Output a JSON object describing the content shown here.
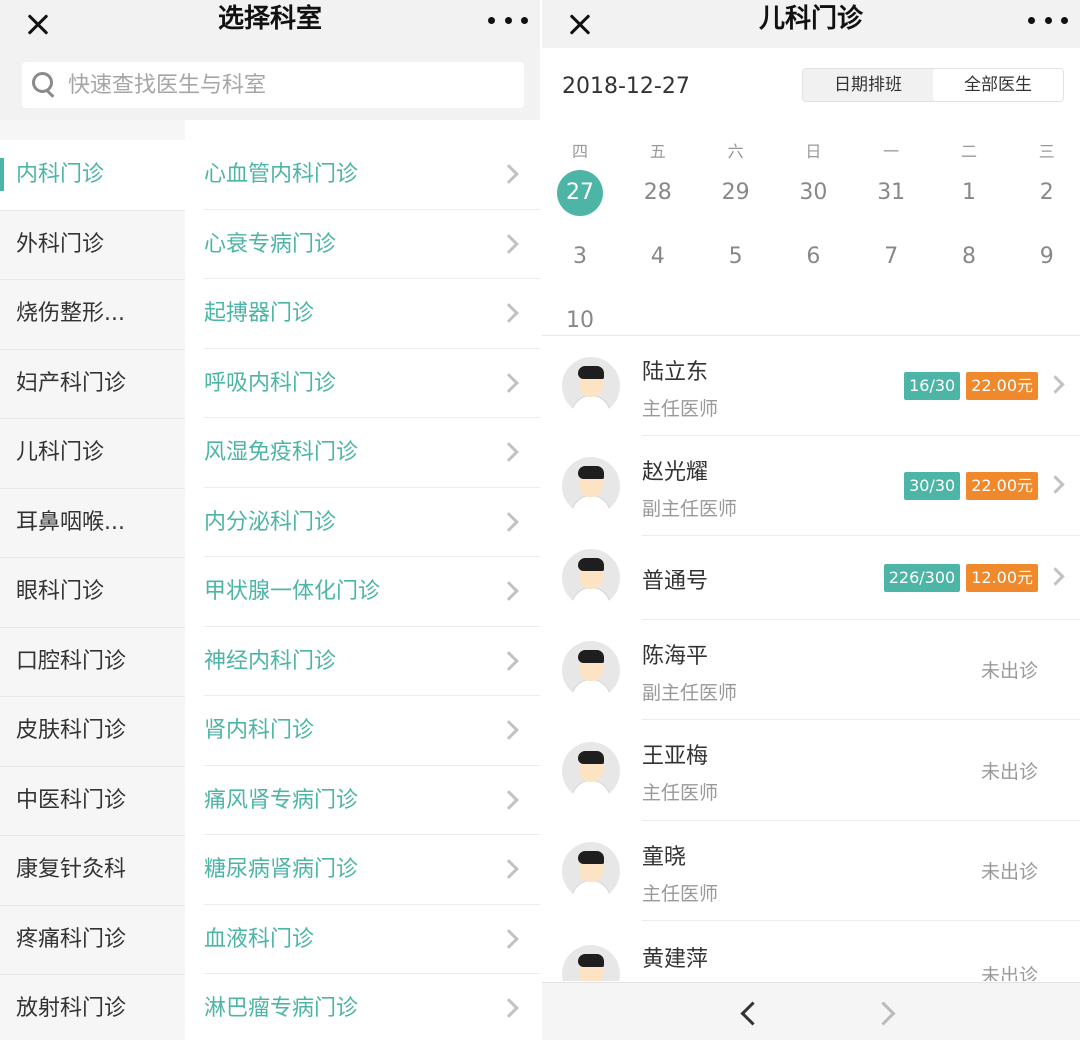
{
  "left": {
    "header": {
      "title": "选择科室"
    },
    "search": {
      "placeholder": "快速查找医生与科室",
      "value": ""
    },
    "sidebar": {
      "items": [
        {
          "label": "内科门诊",
          "active": true
        },
        {
          "label": "外科门诊",
          "active": false
        },
        {
          "label": "烧伤整形...",
          "active": false
        },
        {
          "label": "妇产科门诊",
          "active": false
        },
        {
          "label": "儿科门诊",
          "active": false
        },
        {
          "label": "耳鼻咽喉...",
          "active": false
        },
        {
          "label": "眼科门诊",
          "active": false
        },
        {
          "label": "口腔科门诊",
          "active": false
        },
        {
          "label": "皮肤科门诊",
          "active": false
        },
        {
          "label": "中医科门诊",
          "active": false
        },
        {
          "label": "康复针灸科",
          "active": false
        },
        {
          "label": "疼痛科门诊",
          "active": false
        },
        {
          "label": "放射科门诊",
          "active": false
        }
      ]
    },
    "sub_departments": [
      "心血管内科门诊",
      "心衰专病门诊",
      "起搏器门诊",
      "呼吸内科门诊",
      "风湿免疫科门诊",
      "内分泌科门诊",
      "甲状腺一体化门诊",
      "神经内科门诊",
      "肾内科门诊",
      "痛风肾专病门诊",
      "糖尿病肾病门诊",
      "血液科门诊",
      "淋巴瘤专病门诊"
    ]
  },
  "right": {
    "header": {
      "title": "儿科门诊"
    },
    "date": "2018-12-27",
    "segments": {
      "by_date": "日期排班",
      "all_doctors": "全部医生"
    },
    "calendar": {
      "weekdays": [
        "四",
        "五",
        "六",
        "日",
        "一",
        "二",
        "三"
      ],
      "days": [
        "27",
        "28",
        "29",
        "30",
        "31",
        "1",
        "2",
        "3",
        "4",
        "5",
        "6",
        "7",
        "8",
        "9",
        "10"
      ],
      "selected": "27"
    },
    "doctors": [
      {
        "name": "陆立东",
        "title": "主任医师",
        "quota": "16/30",
        "price": "22.00元",
        "status": ""
      },
      {
        "name": "赵光耀",
        "title": "副主任医师",
        "quota": "30/30",
        "price": "22.00元",
        "status": ""
      },
      {
        "name": "普通号",
        "title": "",
        "quota": "226/300",
        "price": "12.00元",
        "status": ""
      },
      {
        "name": "陈海平",
        "title": "副主任医师",
        "quota": "",
        "price": "",
        "status": "未出诊"
      },
      {
        "name": "王亚梅",
        "title": "主任医师",
        "quota": "",
        "price": "",
        "status": "未出诊"
      },
      {
        "name": "童晓",
        "title": "主任医师",
        "quota": "",
        "price": "",
        "status": "未出诊"
      },
      {
        "name": "黄建萍",
        "title": "",
        "quota": "",
        "price": "",
        "status": "未出诊"
      }
    ]
  },
  "colors": {
    "accent": "#4cb5a6",
    "price": "#f0882c"
  },
  "icons": [
    "close-icon",
    "more-icon",
    "search-icon",
    "chevron-right-icon",
    "back-arrow-icon",
    "forward-arrow-icon",
    "doctor-avatar"
  ]
}
